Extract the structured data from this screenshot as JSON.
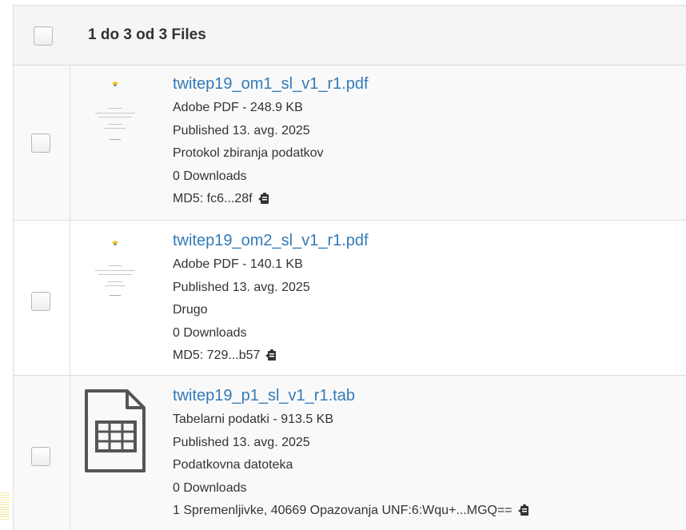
{
  "header": {
    "title": "1 do 3 od 3 Files"
  },
  "files": [
    {
      "name": "twitep19_om1_sl_v1_r1.pdf",
      "type_size": "Adobe PDF - 248.9 KB",
      "published": "Published 13. avg. 2025",
      "category": "Protokol zbiranja podatkov",
      "downloads": "0 Downloads",
      "checksum": "MD5: fc6...28f",
      "thumbnail": "pdf-page-thumbnail"
    },
    {
      "name": "twitep19_om2_sl_v1_r1.pdf",
      "type_size": "Adobe PDF - 140.1 KB",
      "published": "Published 13. avg. 2025",
      "category": "Drugo",
      "downloads": "0 Downloads",
      "checksum": "MD5: 729...b57",
      "thumbnail": "pdf-page-thumbnail"
    },
    {
      "name": "twitep19_p1_sl_v1_r1.tab",
      "type_size": "Tabelarni podatki - 913.5 KB",
      "published": "Published 13. avg. 2025",
      "category": "Podatkovna datoteka",
      "downloads": "0 Downloads",
      "checksum": "1 Spremenljivke, 40669 Opazovanja UNF:6:Wqu+...MGQ==",
      "thumbnail": "tabular-file-icon"
    }
  ],
  "icons": {
    "copy": "clipboard-copy-icon"
  },
  "colors": {
    "link": "#337ab7",
    "text": "#333333",
    "header_bg": "#f5f5f5",
    "border": "#dddddd"
  }
}
